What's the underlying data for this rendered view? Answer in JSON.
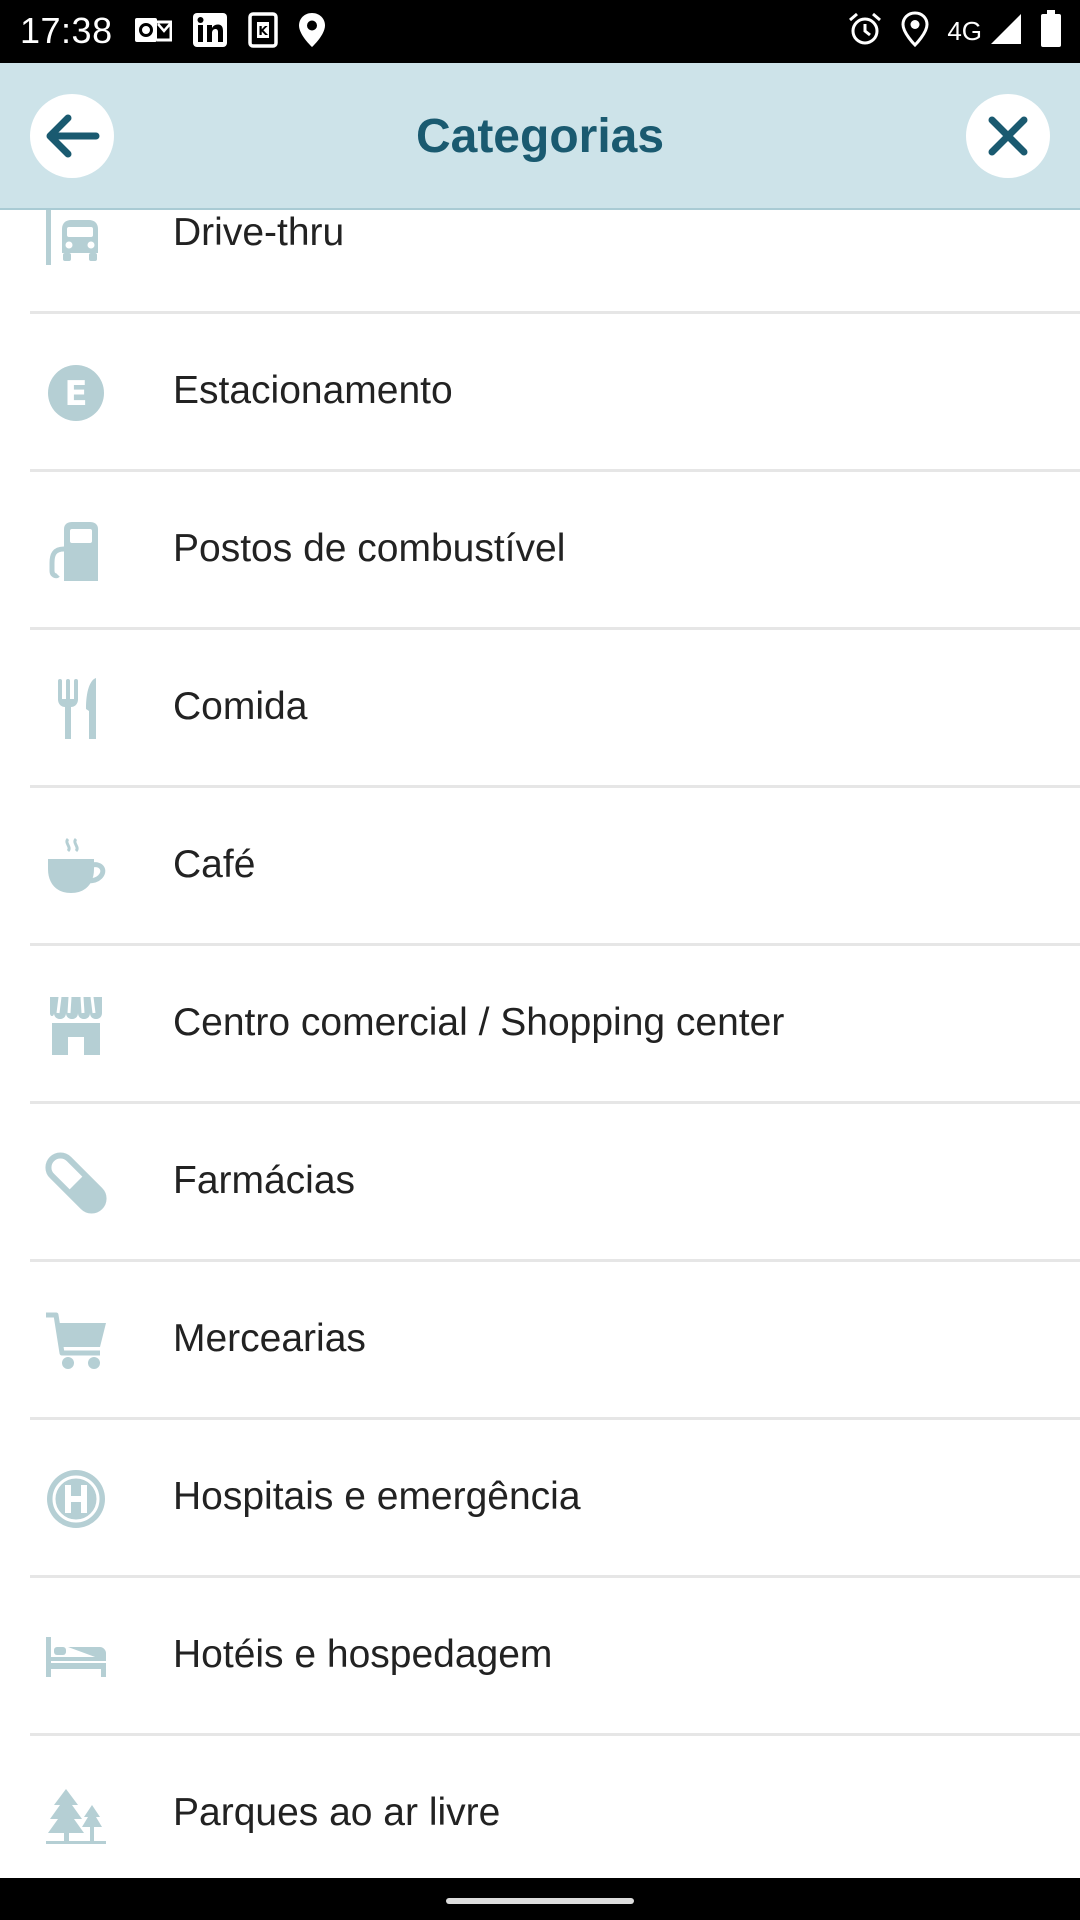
{
  "status_bar": {
    "time": "17:38",
    "network": "4G",
    "icons": [
      "outlook-icon",
      "linkedin-icon",
      "k-app-icon",
      "location-icon",
      "alarm-icon",
      "location-icon",
      "signal-icon",
      "battery-icon"
    ]
  },
  "header": {
    "title": "Categorias",
    "back_icon": "arrow-left-icon",
    "close_icon": "close-icon"
  },
  "colors": {
    "header_bg": "#cde3e9",
    "title": "#1a5a70",
    "icon_tint": "#b5cfd4",
    "text": "#222222"
  },
  "categories": [
    {
      "label": "Drive-thru",
      "icon": "drive-thru-icon"
    },
    {
      "label": "Estacionamento",
      "icon": "parking-icon"
    },
    {
      "label": "Postos de combustível",
      "icon": "fuel-station-icon"
    },
    {
      "label": "Comida",
      "icon": "fork-knife-icon"
    },
    {
      "label": "Café",
      "icon": "coffee-cup-icon"
    },
    {
      "label": "Centro comercial / Shopping center",
      "icon": "storefront-icon"
    },
    {
      "label": "Farmácias",
      "icon": "pill-icon"
    },
    {
      "label": "Mercearias",
      "icon": "shopping-cart-icon"
    },
    {
      "label": "Hospitais e emergência",
      "icon": "hospital-icon"
    },
    {
      "label": "Hotéis e hospedagem",
      "icon": "bed-icon"
    },
    {
      "label": "Parques ao ar livre",
      "icon": "trees-icon"
    }
  ]
}
